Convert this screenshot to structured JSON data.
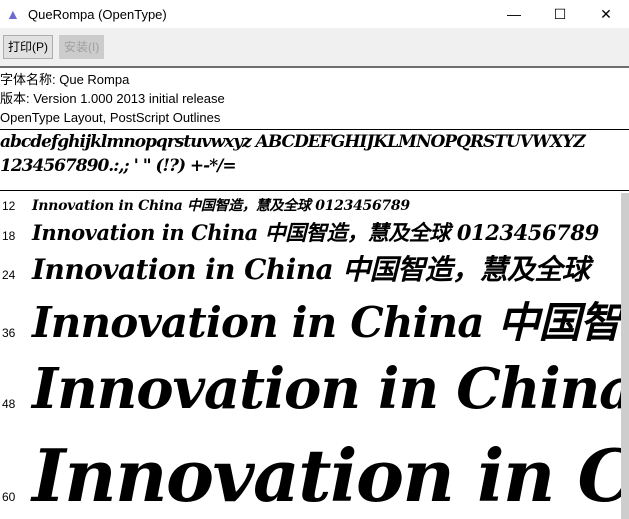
{
  "window": {
    "title": "QueRompa (OpenType)",
    "minimize": "—",
    "maximize": "☐",
    "close": "✕"
  },
  "toolbar": {
    "print": "打印(P)",
    "install": "安装(I)"
  },
  "info": {
    "name": "字体名称: Que Rompa",
    "version": "版本: Version 1.000 2013 initial release",
    "type": "OpenType Layout, PostScript Outlines"
  },
  "charset": {
    "line1": "abcdefghijklmnopqrstuvwxyz ABCDEFGHIJKLMNOPQRSTUVWXYZ",
    "line2": "1234567890.:,; ' \" (!?) +-*/="
  },
  "samples": [
    {
      "size": "12",
      "text": "Innovation in China 中国智造，慧及全球 0123456789"
    },
    {
      "size": "18",
      "text": "Innovation in China 中国智造，慧及全球 0123456789"
    },
    {
      "size": "24",
      "text": "Innovation in China 中国智造，慧及全球"
    },
    {
      "size": "36",
      "text": "Innovation in China 中国智造"
    },
    {
      "size": "48",
      "text": "Innovation in China"
    },
    {
      "size": "60",
      "text": "Innovation in China"
    }
  ]
}
